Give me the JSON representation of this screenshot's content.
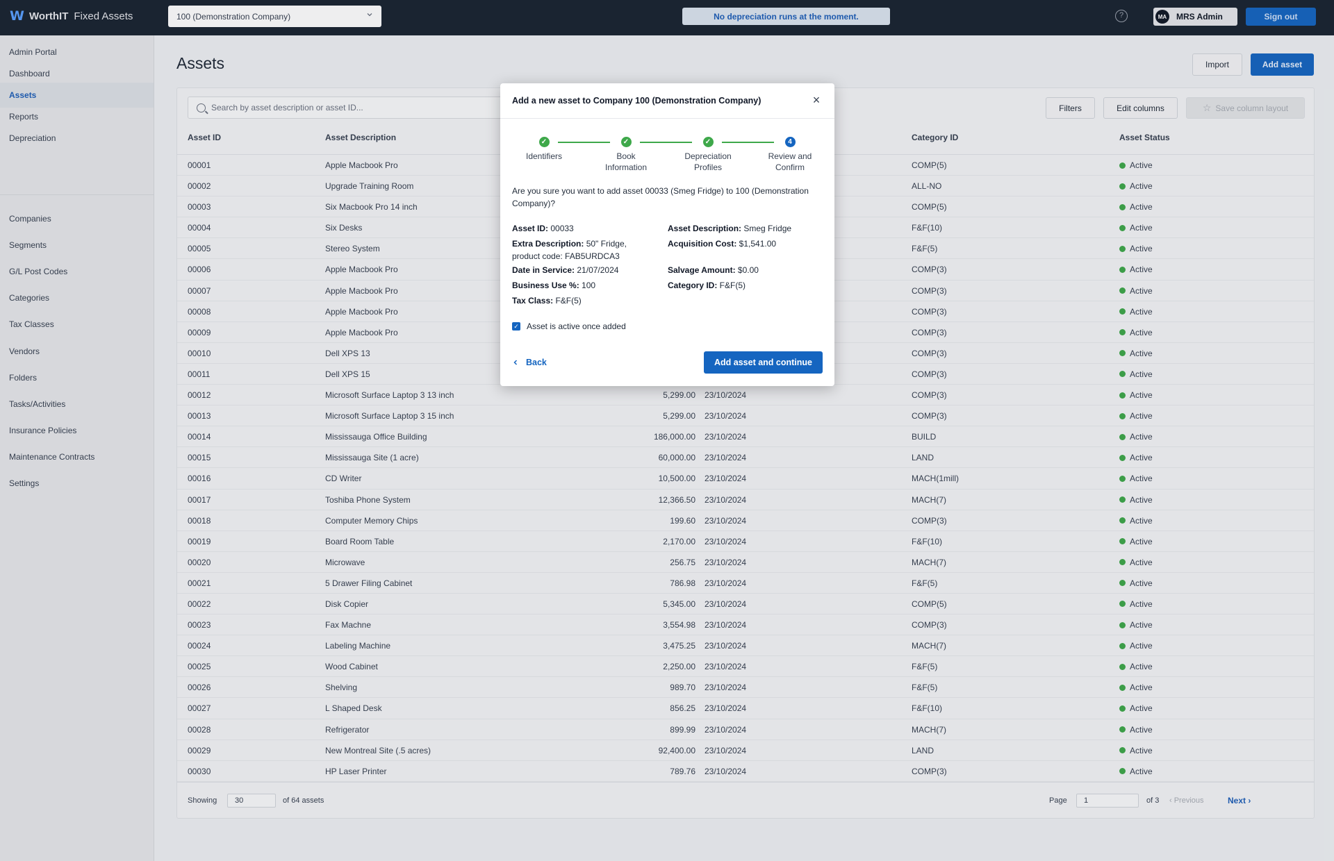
{
  "app": {
    "brand_strong": "WorthIT",
    "brand_rest": "Fixed Assets",
    "logo_glyph": "W"
  },
  "topbar": {
    "company_select": "100 (Demonstration Company)",
    "notice": "No depreciation runs at the moment.",
    "help_glyph": "?",
    "user_initials": "MA",
    "user_name": "MRS Admin",
    "signout": "Sign out"
  },
  "sidebar": {
    "group1": [
      "Admin Portal",
      "Dashboard",
      "Assets",
      "Reports",
      "Depreciation"
    ],
    "group2": [
      "Companies",
      "Segments",
      "G/L Post Codes",
      "Categories",
      "Tax Classes",
      "Vendors",
      "Folders",
      "Tasks/Activities",
      "Insurance Policies",
      "Maintenance Contracts",
      "Settings"
    ],
    "active": "Assets"
  },
  "page": {
    "title": "Assets",
    "import": "Import",
    "add_asset": "Add asset"
  },
  "toolbar": {
    "search_placeholder": "Search by asset description or asset ID...",
    "filters": "Filters",
    "edit_columns": "Edit columns",
    "save_layout": "Save column layout"
  },
  "table": {
    "headers": {
      "id": "Asset ID",
      "desc": "Asset Description",
      "cat": "Category ID",
      "status": "Asset Status"
    },
    "rows": [
      {
        "id": "00001",
        "desc": "Apple Macbook Pro",
        "cost": "",
        "date": "",
        "cat": "COMP(5)",
        "status": "Active"
      },
      {
        "id": "00002",
        "desc": "Upgrade Training Room",
        "cost": "",
        "date": "",
        "cat": "ALL-NO",
        "status": "Active"
      },
      {
        "id": "00003",
        "desc": "Six Macbook Pro 14 inch",
        "cost": "",
        "date": "",
        "cat": "COMP(5)",
        "status": "Active"
      },
      {
        "id": "00004",
        "desc": "Six Desks",
        "cost": "",
        "date": "",
        "cat": "F&F(10)",
        "status": "Active"
      },
      {
        "id": "00005",
        "desc": "Stereo System",
        "cost": "",
        "date": "",
        "cat": "F&F(5)",
        "status": "Active"
      },
      {
        "id": "00006",
        "desc": "Apple Macbook Pro",
        "cost": "",
        "date": "",
        "cat": "COMP(3)",
        "status": "Active"
      },
      {
        "id": "00007",
        "desc": "Apple Macbook Pro",
        "cost": "",
        "date": "",
        "cat": "COMP(3)",
        "status": "Active"
      },
      {
        "id": "00008",
        "desc": "Apple Macbook Pro",
        "cost": "",
        "date": "",
        "cat": "COMP(3)",
        "status": "Active"
      },
      {
        "id": "00009",
        "desc": "Apple Macbook Pro",
        "cost": "",
        "date": "",
        "cat": "COMP(3)",
        "status": "Active"
      },
      {
        "id": "00010",
        "desc": "Dell XPS 13",
        "cost": "",
        "date": "",
        "cat": "COMP(3)",
        "status": "Active"
      },
      {
        "id": "00011",
        "desc": "Dell XPS 15",
        "cost": "",
        "date": "",
        "cat": "COMP(3)",
        "status": "Active"
      },
      {
        "id": "00012",
        "desc": "Microsoft Surface Laptop 3 13 inch",
        "cost": "5,299.00",
        "date": "23/10/2024",
        "cat": "COMP(3)",
        "status": "Active"
      },
      {
        "id": "00013",
        "desc": "Microsoft Surface Laptop 3 15 inch",
        "cost": "5,299.00",
        "date": "23/10/2024",
        "cat": "COMP(3)",
        "status": "Active"
      },
      {
        "id": "00014",
        "desc": "Mississauga Office Building",
        "cost": "186,000.00",
        "date": "23/10/2024",
        "cat": "BUILD",
        "status": "Active"
      },
      {
        "id": "00015",
        "desc": "Mississauga Site (1 acre)",
        "cost": "60,000.00",
        "date": "23/10/2024",
        "cat": "LAND",
        "status": "Active"
      },
      {
        "id": "00016",
        "desc": "CD Writer",
        "cost": "10,500.00",
        "date": "23/10/2024",
        "cat": "MACH(1mill)",
        "status": "Active"
      },
      {
        "id": "00017",
        "desc": "Toshiba Phone System",
        "cost": "12,366.50",
        "date": "23/10/2024",
        "cat": "MACH(7)",
        "status": "Active"
      },
      {
        "id": "00018",
        "desc": "Computer Memory Chips",
        "cost": "199.60",
        "date": "23/10/2024",
        "cat": "COMP(3)",
        "status": "Active"
      },
      {
        "id": "00019",
        "desc": "Board Room Table",
        "cost": "2,170.00",
        "date": "23/10/2024",
        "cat": "F&F(10)",
        "status": "Active"
      },
      {
        "id": "00020",
        "desc": "Microwave",
        "cost": "256.75",
        "date": "23/10/2024",
        "cat": "MACH(7)",
        "status": "Active"
      },
      {
        "id": "00021",
        "desc": "5 Drawer Filing Cabinet",
        "cost": "786.98",
        "date": "23/10/2024",
        "cat": "F&F(5)",
        "status": "Active"
      },
      {
        "id": "00022",
        "desc": "Disk Copier",
        "cost": "5,345.00",
        "date": "23/10/2024",
        "cat": "COMP(5)",
        "status": "Active"
      },
      {
        "id": "00023",
        "desc": "Fax Machne",
        "cost": "3,554.98",
        "date": "23/10/2024",
        "cat": "COMP(3)",
        "status": "Active"
      },
      {
        "id": "00024",
        "desc": "Labeling Machine",
        "cost": "3,475.25",
        "date": "23/10/2024",
        "cat": "MACH(7)",
        "status": "Active"
      },
      {
        "id": "00025",
        "desc": "Wood Cabinet",
        "cost": "2,250.00",
        "date": "23/10/2024",
        "cat": "F&F(5)",
        "status": "Active"
      },
      {
        "id": "00026",
        "desc": "Shelving",
        "cost": "989.70",
        "date": "23/10/2024",
        "cat": "F&F(5)",
        "status": "Active"
      },
      {
        "id": "00027",
        "desc": "L Shaped Desk",
        "cost": "856.25",
        "date": "23/10/2024",
        "cat": "F&F(10)",
        "status": "Active"
      },
      {
        "id": "00028",
        "desc": "Refrigerator",
        "cost": "899.99",
        "date": "23/10/2024",
        "cat": "MACH(7)",
        "status": "Active"
      },
      {
        "id": "00029",
        "desc": "New Montreal Site (.5 acres)",
        "cost": "92,400.00",
        "date": "23/10/2024",
        "cat": "LAND",
        "status": "Active"
      },
      {
        "id": "00030",
        "desc": "HP Laser Printer",
        "cost": "789.76",
        "date": "23/10/2024",
        "cat": "COMP(3)",
        "status": "Active"
      }
    ]
  },
  "footer": {
    "showing": "Showing",
    "page_size": "30",
    "of_assets": "of 64 assets",
    "page": "Page",
    "page_number": "1",
    "of_pages": "of 3",
    "previous": "‹  Previous",
    "next": "Next  ›"
  },
  "modal": {
    "title": "Add a new asset to Company 100 (Demonstration Company)",
    "steps": [
      {
        "label": "Identifiers",
        "state": "done"
      },
      {
        "label": "Book\nInformation",
        "state": "done"
      },
      {
        "label": "Depreciation\nProfiles",
        "state": "done"
      },
      {
        "label": "Review and\nConfirm",
        "state": "current",
        "number": "4"
      }
    ],
    "question": "Are you sure you want to add asset 00033 (Smeg Fridge) to 100 (Demonstration Company)?",
    "left": [
      {
        "k": "Asset ID:",
        "v": " 00033"
      },
      {
        "k": "Extra Description:",
        "v": " 50\" Fridge, product code: FAB5URDCA3"
      },
      {
        "k": "Date in Service:",
        "v": " 21/07/2024"
      },
      {
        "k": "Business Use %:",
        "v": " 100"
      },
      {
        "k": "Tax Class:",
        "v": " F&F(5)"
      }
    ],
    "right": [
      {
        "k": "Asset Description:",
        "v": " Smeg Fridge"
      },
      {
        "k": "Acquisition Cost:",
        "v": " $1,541.00"
      },
      {
        "k": "Salvage Amount:",
        "v": " $0.00"
      },
      {
        "k": "Category ID:",
        "v": " F&F(5)"
      }
    ],
    "active_checkbox": "Asset is active once added",
    "back": "Back",
    "primary": "Add asset and continue"
  },
  "colors": {
    "accent": "#1565c0",
    "topbar": "#1a2431",
    "status_active": "#3ea84a"
  }
}
